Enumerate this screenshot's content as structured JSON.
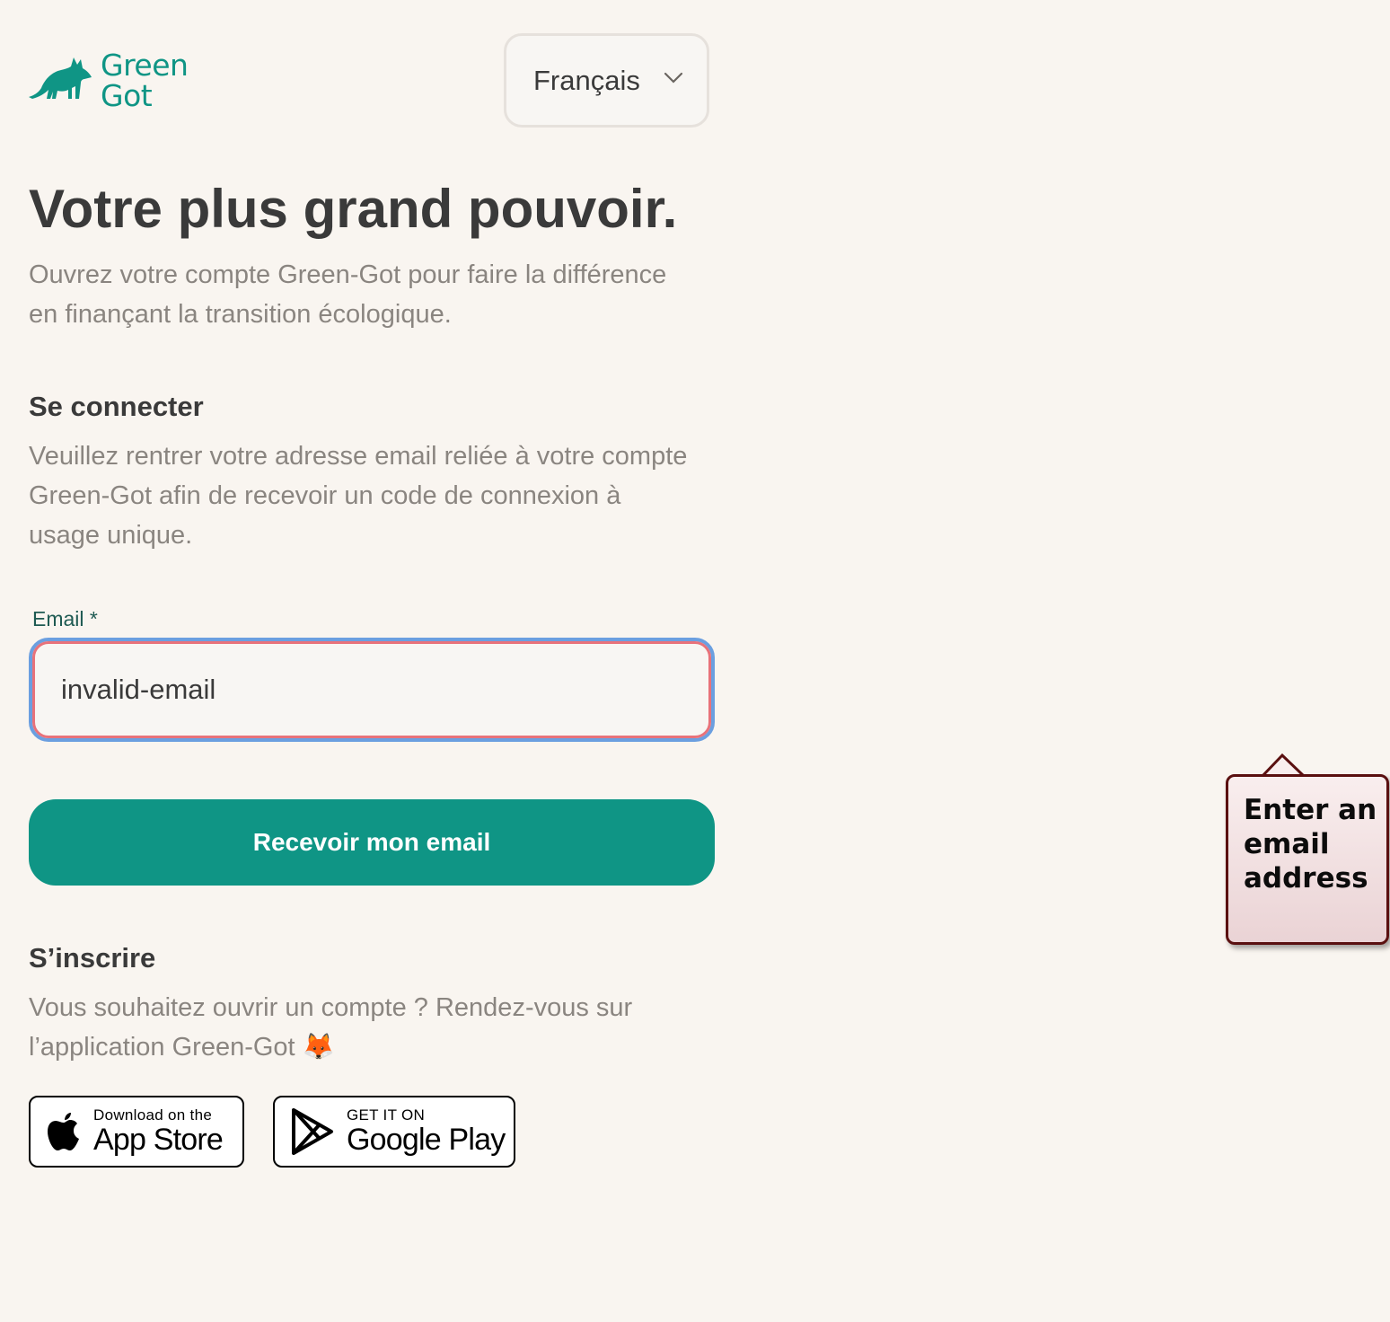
{
  "brand": {
    "name_line1": "Green",
    "name_line2": "Got",
    "color": "#0f9585"
  },
  "language_select": {
    "value": "Français"
  },
  "hero": {
    "title": "Votre plus grand pouvoir.",
    "subtitle": "Ouvrez votre compte Green-Got pour faire la différence en finançant la transition écologique."
  },
  "login": {
    "title": "Se connecter",
    "description": "Veuillez rentrer votre adresse email reliée à votre compte Green-Got afin de recevoir un code de connexion à usage unique.",
    "email_label": "Email *",
    "email_value": "invalid-email",
    "submit_label": "Recevoir mon email"
  },
  "signup": {
    "title": "S’inscrire",
    "description": "Vous souhaitez ouvrir un compte ? Rendez-vous sur l’application Green-Got 🦊"
  },
  "stores": {
    "appstore_small": "Download on the",
    "appstore_big": "App Store",
    "gplay_small": "GET IT ON",
    "gplay_big": "Google Play"
  },
  "validation_tooltip": {
    "message": "Enter an email address"
  },
  "colors": {
    "background": "#f9f5f0",
    "accent": "#0f9585",
    "error_border": "#e8727a",
    "focus_ring": "#6b9fe0"
  }
}
